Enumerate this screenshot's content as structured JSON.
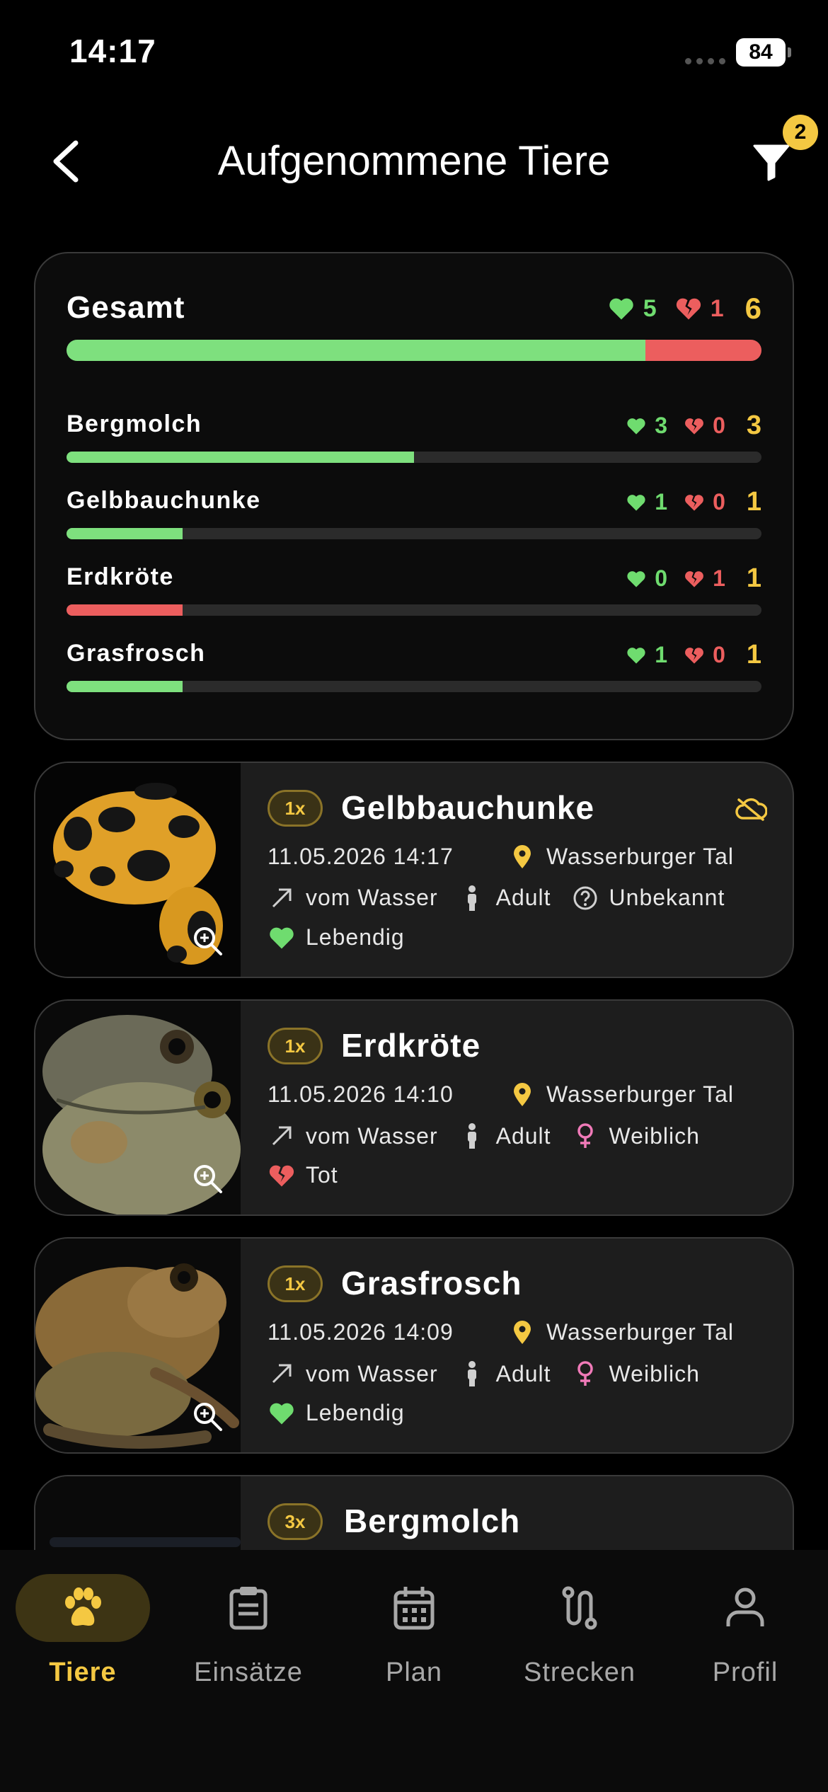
{
  "status_bar": {
    "time": "14:17",
    "battery": "84"
  },
  "header": {
    "title": "Aufgenommene Tiere",
    "filter_count": "2"
  },
  "summary": {
    "title": "Gesamt",
    "alive": "5",
    "dead": "1",
    "total": "6",
    "alive_fraction": 0.833,
    "species": [
      {
        "name": "Bergmolch",
        "alive": "3",
        "dead": "0",
        "total": "3",
        "alive_fraction": 0.5,
        "dead_fraction": 0
      },
      {
        "name": "Gelbbauchunke",
        "alive": "1",
        "dead": "0",
        "total": "1",
        "alive_fraction": 0.167,
        "dead_fraction": 0
      },
      {
        "name": "Erdkröte",
        "alive": "0",
        "dead": "1",
        "total": "1",
        "alive_fraction": 0,
        "dead_fraction": 0.167
      },
      {
        "name": "Grasfrosch",
        "alive": "1",
        "dead": "0",
        "total": "1",
        "alive_fraction": 0.167,
        "dead_fraction": 0
      }
    ]
  },
  "entries": [
    {
      "count": "1x",
      "name": "Gelbbauchunke",
      "datetime": "11.05.2026 14:17",
      "location": "Wasserburger Tal",
      "direction": "vom Wasser",
      "age": "Adult",
      "sex": "Unbekannt",
      "condition": "Lebendig",
      "sex_icon": "question-circle-icon",
      "condition_icon": "heart-icon",
      "has_cloud_icon": true
    },
    {
      "count": "1x",
      "name": "Erdkröte",
      "datetime": "11.05.2026 14:10",
      "location": "Wasserburger Tal",
      "direction": "vom Wasser",
      "age": "Adult",
      "sex": "Weiblich",
      "condition": "Tot",
      "sex_icon": "female-icon",
      "condition_icon": "broken-heart-icon"
    },
    {
      "count": "1x",
      "name": "Grasfrosch",
      "datetime": "11.05.2026 14:09",
      "location": "Wasserburger Tal",
      "direction": "vom Wasser",
      "age": "Adult",
      "sex": "Weiblich",
      "condition": "Lebendig",
      "sex_icon": "female-icon",
      "condition_icon": "heart-icon"
    },
    {
      "count": "3x",
      "name": "Bergmolch"
    }
  ],
  "nav": {
    "items": [
      {
        "label": "Tiere",
        "icon": "paw-icon",
        "active": true
      },
      {
        "label": "Einsätze",
        "icon": "clipboard-icon"
      },
      {
        "label": "Plan",
        "icon": "calendar-icon"
      },
      {
        "label": "Strecken",
        "icon": "route-icon"
      },
      {
        "label": "Profil",
        "icon": "person-icon"
      }
    ]
  },
  "colors": {
    "alive": "#6fdc6f",
    "dead": "#ec5e5e",
    "accent": "#f4c842",
    "female": "#f07ab8"
  }
}
